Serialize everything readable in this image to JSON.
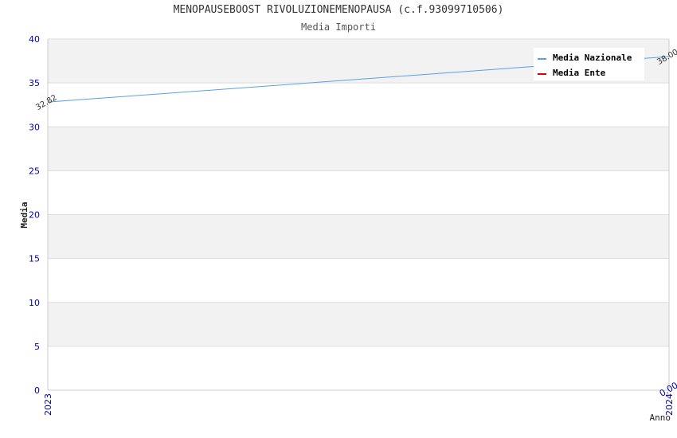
{
  "title": "MENOPAUSEBOOST RIVOLUZIONEMENOPAUSA (c.f.93099710506)",
  "subtitle": "Media Importi",
  "chart_data": {
    "type": "line",
    "x": [
      "2023",
      "2024"
    ],
    "ylabel": "Media",
    "xlabel": "Anno",
    "ylim": [
      0,
      40
    ],
    "yticks": [
      0,
      5,
      10,
      15,
      20,
      25,
      30,
      35,
      40
    ],
    "grid": true,
    "legend_position": "top-right",
    "series": [
      {
        "name": "Media Nazionale",
        "color": "#5aa0e6",
        "values": [
          32.82,
          38.0
        ],
        "labels": [
          "32.82",
          "38.00"
        ]
      },
      {
        "name": "Media Ente",
        "color": "#dd0000",
        "values": [
          null,
          0.0
        ],
        "labels": [
          "",
          "0.00"
        ]
      }
    ]
  }
}
